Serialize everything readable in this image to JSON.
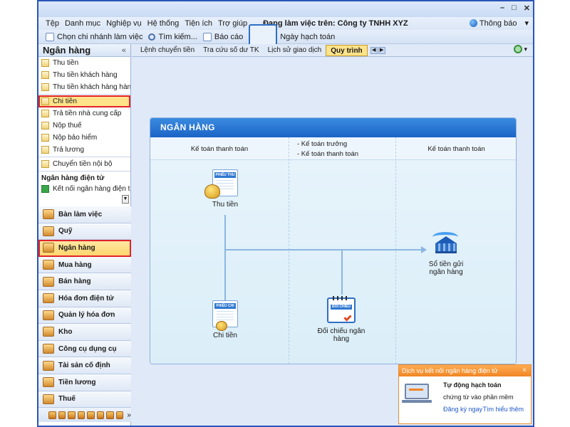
{
  "window": {
    "controls": [
      "–",
      "□",
      "✕"
    ]
  },
  "menu": {
    "items": [
      "Tệp",
      "Danh mục",
      "Nghiệp vụ",
      "Hệ thống",
      "Tiện ích",
      "Trợ giúp"
    ],
    "company": "Đang làm việc trên:  Công ty TNHH XYZ",
    "notify_label": "Thông báo",
    "notify_arrow": "▾"
  },
  "toolbar": {
    "branch_label": "Chọn chi nhánh làm việc",
    "search_label": "Tìm kiếm...",
    "report_label": "Báo cáo",
    "date_label": "Ngày hạch toán"
  },
  "sidebar": {
    "title": "Ngân hàng",
    "collapse": "«",
    "items": [
      {
        "label": "Thu tiền"
      },
      {
        "label": "Thu tiền khách hàng"
      },
      {
        "label": "Thu tiền khách hàng hàng l..."
      },
      {
        "label": "Chi tiền"
      },
      {
        "label": "Trả tiền nhà cung cấp"
      },
      {
        "label": "Nộp thuế"
      },
      {
        "label": "Nộp bảo hiểm"
      },
      {
        "label": "Trả lương"
      },
      {
        "label": "Chuyển tiền nội bộ"
      }
    ],
    "group_label": "Ngân hàng điện tử",
    "group_item": "Kết nối ngân hàng điện tử",
    "modules": [
      {
        "label": "Bàn làm việc",
        "icon": "desk-icon"
      },
      {
        "label": "Quỹ",
        "icon": "safe-icon"
      },
      {
        "label": "Ngân hàng",
        "icon": "bank-icon"
      },
      {
        "label": "Mua hàng",
        "icon": "buy-icon"
      },
      {
        "label": "Bán hàng",
        "icon": "sell-icon"
      },
      {
        "label": "Hóa đơn điện tử",
        "icon": "einvoice-icon"
      },
      {
        "label": "Quản lý hóa đơn",
        "icon": "invoice-icon"
      },
      {
        "label": "Kho",
        "icon": "warehouse-icon"
      },
      {
        "label": "Công cụ dụng cụ",
        "icon": "tools-icon"
      },
      {
        "label": "Tài sản cố định",
        "icon": "asset-icon"
      },
      {
        "label": "Tiền lương",
        "icon": "salary-icon"
      },
      {
        "label": "Thuế",
        "icon": "tax-icon"
      }
    ],
    "footer_more": "»"
  },
  "tabs": {
    "items": [
      "Lệnh chuyển tiền",
      "Tra cứu số dư TK",
      "Lịch sử giao dịch",
      "Quy trình"
    ],
    "active": "Quy trình",
    "gear_arrow": "▾"
  },
  "process": {
    "title": "NGÂN HÀNG",
    "columns": {
      "left": "Kế toán thanh toán",
      "mid1": "- Kế toán trưởng",
      "mid2": "- Kế toán thanh toán",
      "right": "Kế toán thanh toán"
    },
    "nodes": {
      "receipt": "Thu tiền",
      "receipt_doc": "PHIẾU THU",
      "payment": "Chi tiền",
      "payment_doc": "PHIẾU CHI",
      "reconcile": "Đối chiếu ngân hàng",
      "reconcile_doc": "ĐỐI CHIẾU",
      "deposit": "Sổ tiền gửi ngân hàng"
    }
  },
  "popup": {
    "header": "Dịch vụ kết nối ngân hàng điện tử",
    "close": "×",
    "title": "Tự động hạch toán",
    "desc": "chứng từ vào phần mềm",
    "link_register": "Đăng ký ngay",
    "link_more": "Tìm hiểu thêm"
  }
}
